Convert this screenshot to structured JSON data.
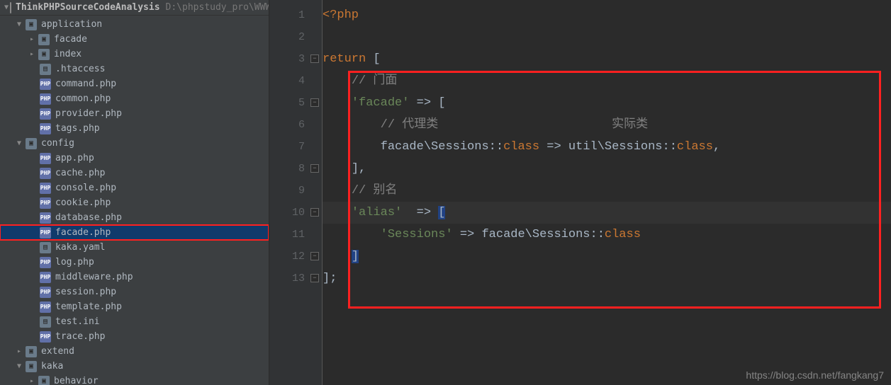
{
  "project": {
    "name": "ThinkPHPSourceCodeAnalysis",
    "path": "D:\\phpstudy_pro\\WWW\\Tl"
  },
  "tree": {
    "n_application": "application",
    "n_facade": "facade",
    "n_index": "index",
    "f_htaccess": ".htaccess",
    "f_command": "command.php",
    "f_common": "common.php",
    "f_provider": "provider.php",
    "f_tags": "tags.php",
    "n_config": "config",
    "f_app": "app.php",
    "f_cache": "cache.php",
    "f_console": "console.php",
    "f_cookie": "cookie.php",
    "f_database": "database.php",
    "f_facadephp": "facade.php",
    "f_kakayaml": "kaka.yaml",
    "f_log": "log.php",
    "f_middleware": "middleware.php",
    "f_session": "session.php",
    "f_template": "template.php",
    "f_testini": "test.ini",
    "f_trace": "trace.php",
    "n_extend": "extend",
    "n_kaka": "kaka",
    "n_behavior": "behavior"
  },
  "lines": {
    "l1": "1",
    "l2": "2",
    "l3": "3",
    "l4": "4",
    "l5": "5",
    "l6": "6",
    "l7": "7",
    "l8": "8",
    "l9": "9",
    "l10": "10",
    "l11": "11",
    "l12": "12",
    "l13": "13"
  },
  "code": {
    "phpopen": "<?php",
    "return": "return",
    "lb": " [",
    "c1": "// 门面",
    "k_facade": "'facade'",
    "arrow": " => ",
    "lb2": "[",
    "c2": "// 代理类",
    "c3": "实际类",
    "seg_a": "facade\\Sessions::",
    "class": "class",
    "seg_b": " => util\\Sessions::",
    "comma": ",",
    "rb": "],",
    "c4": "// 别名",
    "k_alias": "'alias'",
    "arrow2": "  => ",
    "k_sessions": "'Sessions'",
    "seg_c": " => facade\\Sessions::",
    "rb2": "]",
    "end": "];"
  },
  "watermark": "https://blog.csdn.net/fangkang7"
}
